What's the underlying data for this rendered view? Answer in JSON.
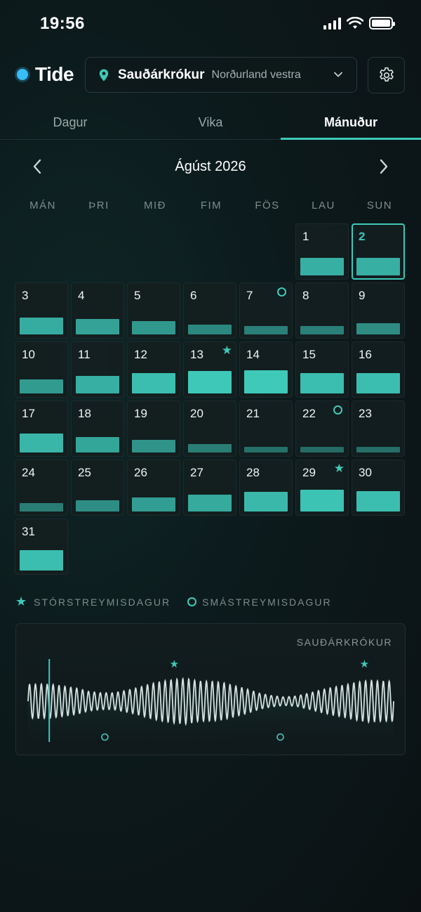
{
  "status_bar": {
    "time": "19:56"
  },
  "app": {
    "name": "Tide"
  },
  "location": {
    "name": "Sauðárkrókur",
    "region": "Norðurland vestra"
  },
  "tabs": [
    {
      "label": "Dagur",
      "active": false
    },
    {
      "label": "Vika",
      "active": false
    },
    {
      "label": "Mánuður",
      "active": true
    }
  ],
  "calendar": {
    "month_title": "Ágúst 2026",
    "weekdays": [
      "MÁN",
      "ÞRI",
      "MIÐ",
      "FIM",
      "FÖS",
      "LAU",
      "SUN"
    ],
    "first_weekday_index": 5,
    "today": 2,
    "days": [
      {
        "day": "1",
        "range": 0.74,
        "marker": null
      },
      {
        "day": "2",
        "range": 0.74,
        "marker": null
      },
      {
        "day": "3",
        "range": 0.72,
        "marker": null
      },
      {
        "day": "4",
        "range": 0.64,
        "marker": null
      },
      {
        "day": "5",
        "range": 0.56,
        "marker": null
      },
      {
        "day": "6",
        "range": 0.42,
        "marker": null
      },
      {
        "day": "7",
        "range": 0.36,
        "marker": "circle"
      },
      {
        "day": "8",
        "range": 0.36,
        "marker": null
      },
      {
        "day": "9",
        "range": 0.46,
        "marker": null
      },
      {
        "day": "10",
        "range": 0.58,
        "marker": null
      },
      {
        "day": "11",
        "range": 0.74,
        "marker": null
      },
      {
        "day": "12",
        "range": 0.86,
        "marker": null
      },
      {
        "day": "13",
        "range": 0.94,
        "marker": "star"
      },
      {
        "day": "14",
        "range": 0.98,
        "marker": null
      },
      {
        "day": "15",
        "range": 0.86,
        "marker": null
      },
      {
        "day": "16",
        "range": 0.86,
        "marker": null
      },
      {
        "day": "17",
        "range": 0.8,
        "marker": null
      },
      {
        "day": "18",
        "range": 0.66,
        "marker": null
      },
      {
        "day": "19",
        "range": 0.52,
        "marker": null
      },
      {
        "day": "20",
        "range": 0.34,
        "marker": null
      },
      {
        "day": "21",
        "range": 0.24,
        "marker": null
      },
      {
        "day": "22",
        "range": 0.18,
        "marker": "circle"
      },
      {
        "day": "23",
        "range": 0.22,
        "marker": null
      },
      {
        "day": "24",
        "range": 0.34,
        "marker": null
      },
      {
        "day": "25",
        "range": 0.48,
        "marker": null
      },
      {
        "day": "26",
        "range": 0.6,
        "marker": null
      },
      {
        "day": "27",
        "range": 0.7,
        "marker": null
      },
      {
        "day": "28",
        "range": 0.82,
        "marker": null
      },
      {
        "day": "29",
        "range": 0.9,
        "marker": "star"
      },
      {
        "day": "30",
        "range": 0.86,
        "marker": null
      },
      {
        "day": "31",
        "range": 0.86,
        "marker": null
      }
    ]
  },
  "legend": {
    "spring_label": "STÓRSTREYMISDAGUR",
    "neap_label": "SMÁSTREYMISDAGUR"
  },
  "tide_chart": {
    "label": "SAUÐÁRKRÓKUR",
    "cycles": 62,
    "current_position": 0.058,
    "envelope": [
      0.72,
      0.74,
      0.72,
      0.64,
      0.56,
      0.42,
      0.36,
      0.36,
      0.46,
      0.58,
      0.74,
      0.86,
      0.94,
      0.98,
      0.86,
      0.86,
      0.8,
      0.66,
      0.52,
      0.34,
      0.24,
      0.18,
      0.22,
      0.34,
      0.48,
      0.6,
      0.7,
      0.82,
      0.9,
      0.86,
      0.86
    ],
    "spring_markers": [
      0.4,
      0.92
    ],
    "neap_markers": [
      0.21,
      0.69
    ]
  },
  "colors": {
    "accent": "#3ec9b9",
    "bar_high": "#3ec9b9",
    "bar_low": "#256b66",
    "today_border": "#3ec9b9",
    "wave": "#d4e2df"
  },
  "icons": {
    "location": "location-pin-icon",
    "dropdown": "chevron-down-icon",
    "settings": "gear-icon",
    "prev": "chevron-left-icon",
    "next": "chevron-right-icon",
    "spring": "star-icon",
    "neap": "circle-icon"
  }
}
